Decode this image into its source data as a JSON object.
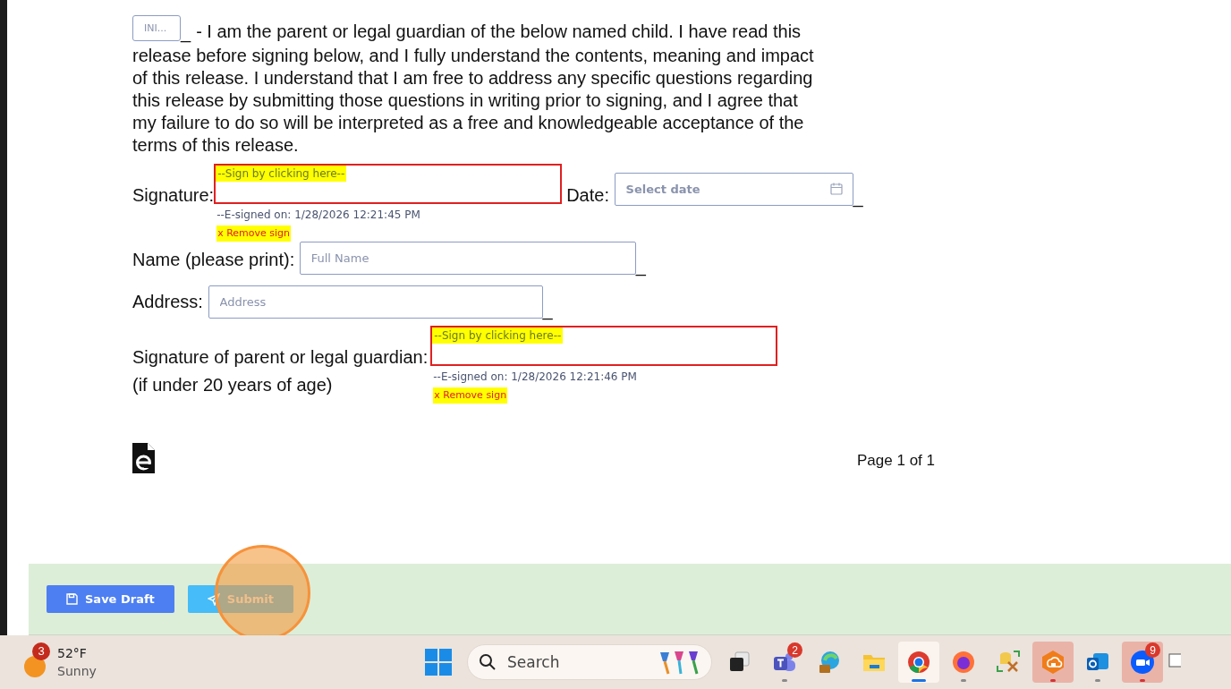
{
  "document": {
    "initials_field": {
      "placeholder": "INI...",
      "suffix": "_"
    },
    "declaration_lines": [
      "- I am the parent or legal guardian of the below named child. I have read this",
      "release before signing below, and I fully understand the contents, meaning and impact",
      "of this release. I understand that I am free to address any specific questions regarding",
      "this release by submitting those questions in writing prior to signing, and I agree that",
      "my failure to do so will be interpreted as a free and knowledgeable acceptance of the",
      "terms of this release."
    ],
    "signature": {
      "label": "Signature:",
      "prompt": "--Sign by clicking here--",
      "signed_on": "--E-signed on: 1/28/2026 12:21:45 PM",
      "remove": "x Remove sign"
    },
    "date": {
      "label": "Date:",
      "placeholder": "Select date",
      "suffix": "_"
    },
    "name": {
      "label": "Name (please print):",
      "placeholder": "Full Name",
      "suffix": "_"
    },
    "address": {
      "label": "Address:",
      "placeholder": "Address",
      "suffix": "_"
    },
    "guardian_signature": {
      "label": "Signature of parent or legal guardian:",
      "note": "(if under 20 years of age)",
      "prompt": "--Sign by clicking here--",
      "signed_on": "--E-signed on: 1/28/2026 12:21:46 PM",
      "remove": "x Remove sign"
    },
    "page_number": "Page 1 of 1"
  },
  "actions": [
    {
      "kind": "save",
      "label": "Save Draft"
    },
    {
      "kind": "submit",
      "label": "Submit"
    }
  ],
  "taskbar": {
    "weather": {
      "badge": "3",
      "temperature": "52°F",
      "condition": "Sunny"
    },
    "search": {
      "placeholder": "Search"
    },
    "apps": [
      {
        "kind": "taskview",
        "open": false,
        "focused": false,
        "attention": false
      },
      {
        "kind": "teams",
        "badge": "2",
        "open": true,
        "focused": false,
        "attention": false
      },
      {
        "kind": "edge",
        "open": false,
        "focused": false,
        "attention": false
      },
      {
        "kind": "folder",
        "open": false,
        "focused": false,
        "attention": false
      },
      {
        "kind": "chrome",
        "open": true,
        "focused": true,
        "attention": false
      },
      {
        "kind": "firefox",
        "open": true,
        "focused": false,
        "attention": false
      },
      {
        "kind": "tools",
        "open": false,
        "focused": false,
        "attention": false
      },
      {
        "kind": "secure",
        "open": true,
        "focused": false,
        "attention": true
      },
      {
        "kind": "outlook",
        "open": true,
        "focused": false,
        "attention": false
      },
      {
        "kind": "zoom",
        "badge": "9",
        "open": true,
        "focused": false,
        "attention": true
      }
    ]
  }
}
